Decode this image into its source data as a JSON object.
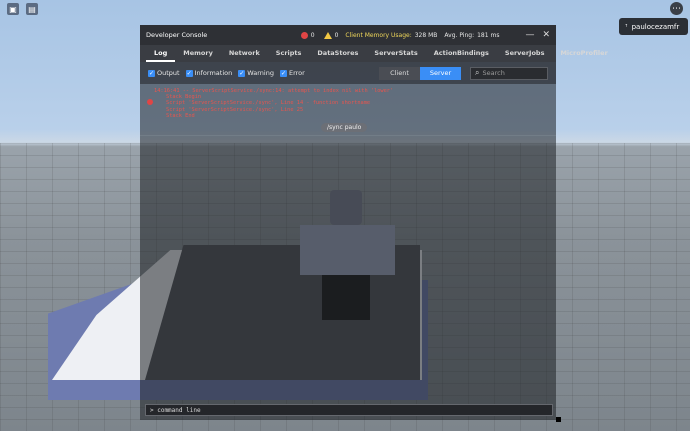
{
  "top_icons": [
    {
      "icon": "roblox-menu-icon",
      "glyph": "▣"
    },
    {
      "icon": "chat-icon",
      "glyph": "▤"
    }
  ],
  "user": {
    "name": "paulocezamfr"
  },
  "console": {
    "title": "Developer Console",
    "errors": "0",
    "warnings": "0",
    "memory_label": "Client Memory Usage:",
    "memory_value": "328 MB",
    "ping_label": "Avg. Ping:",
    "ping_value": "181 ms",
    "minimize": "—",
    "close": "✕",
    "tabs": [
      "Log",
      "Memory",
      "Network",
      "Scripts",
      "DataStores",
      "ServerStats",
      "ActionBindings",
      "ServerJobs",
      "MicroProfiler"
    ],
    "active_tab": "Log",
    "filters": [
      {
        "label": "Output",
        "checked": true
      },
      {
        "label": "Information",
        "checked": true
      },
      {
        "label": "Warning",
        "checked": true
      },
      {
        "label": "Error",
        "checked": true
      }
    ],
    "client_label": "Client",
    "server_label": "Server",
    "active_side": "Server",
    "search_placeholder": "Search",
    "log_lines": [
      "14:16:41 -- ServerScriptService./sync:14: attempt to index nil with 'lower'",
      "Stack Begin",
      "Script 'ServerScriptService./sync', Line 14 - function shortname",
      "Script 'ServerScriptService./sync', Line 25",
      "Stack End"
    ],
    "sync_pill": "/sync paulo",
    "command_placeholder": "> command line"
  },
  "colors": {
    "accent": "#3a8ef6",
    "error": "#e04545",
    "warning": "#f2c744",
    "memory": "#f0d75a"
  }
}
